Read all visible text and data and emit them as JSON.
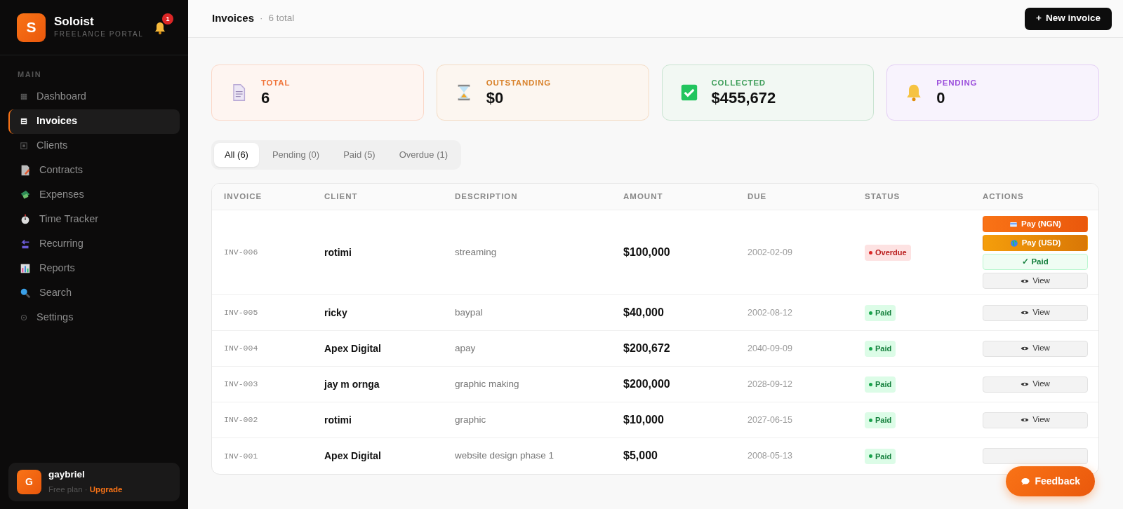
{
  "brand": {
    "logo_letter": "S",
    "name": "Soloist",
    "tagline": "FREELANCE PORTAL",
    "notification_count": "1"
  },
  "sidebar": {
    "section": "MAIN",
    "items": [
      {
        "label": "Dashboard",
        "selected": false
      },
      {
        "label": "Invoices",
        "selected": true
      },
      {
        "label": "Clients",
        "selected": false
      },
      {
        "label": "Contracts",
        "selected": false
      },
      {
        "label": "Expenses",
        "selected": false
      },
      {
        "label": "Time Tracker",
        "selected": false
      },
      {
        "label": "Recurring",
        "selected": false
      },
      {
        "label": "Reports",
        "selected": false
      },
      {
        "label": "Search",
        "selected": false
      },
      {
        "label": "Settings",
        "selected": false
      }
    ]
  },
  "user": {
    "initial": "G",
    "name": "gaybriel",
    "plan": "Free plan",
    "separator": "·",
    "upgrade": "Upgrade"
  },
  "header": {
    "title": "Invoices",
    "separator": "·",
    "count": "6 total",
    "new_button": "New invoice",
    "new_button_icon": "+"
  },
  "stats": [
    {
      "label": "TOTAL",
      "value": "6",
      "color": "#f0743a"
    },
    {
      "label": "OUTSTANDING",
      "value": "$0",
      "color": "#d9822b"
    },
    {
      "label": "COLLECTED",
      "value": "$455,672",
      "color": "#3f9e5a"
    },
    {
      "label": "PENDING",
      "value": "0",
      "color": "#9b4fdc"
    }
  ],
  "filters": [
    {
      "label": "All (6)",
      "selected": true
    },
    {
      "label": "Pending (0)",
      "selected": false
    },
    {
      "label": "Paid (5)",
      "selected": false
    },
    {
      "label": "Overdue (1)",
      "selected": false
    }
  ],
  "table": {
    "columns": [
      "INVOICE",
      "CLIENT",
      "DESCRIPTION",
      "AMOUNT",
      "DUE",
      "STATUS",
      "ACTIONS"
    ],
    "rows": [
      {
        "invoice": "INV-006",
        "client": "rotimi",
        "description": "streaming",
        "amount": "$100,000",
        "due": "2002-02-09",
        "status": {
          "kind": "overdue",
          "label": "Overdue"
        },
        "actions": [
          {
            "kind": "pay_ngn",
            "label": "Pay (NGN)"
          },
          {
            "kind": "pay_usd",
            "label": "Pay (USD)"
          },
          {
            "kind": "mark_paid",
            "label": "✓ Paid"
          },
          {
            "kind": "view",
            "label": "View"
          }
        ]
      },
      {
        "invoice": "INV-005",
        "client": "ricky",
        "description": "baypal",
        "amount": "$40,000",
        "due": "2002-08-12",
        "status": {
          "kind": "paid",
          "label": "Paid"
        },
        "actions": [
          {
            "kind": "view",
            "label": "View"
          }
        ]
      },
      {
        "invoice": "INV-004",
        "client": "Apex Digital",
        "description": "apay",
        "amount": "$200,672",
        "due": "2040-09-09",
        "status": {
          "kind": "paid",
          "label": "Paid"
        },
        "actions": [
          {
            "kind": "view",
            "label": "View"
          }
        ]
      },
      {
        "invoice": "INV-003",
        "client": "jay m ornga",
        "description": "graphic making",
        "amount": "$200,000",
        "due": "2028-09-12",
        "status": {
          "kind": "paid",
          "label": "Paid"
        },
        "actions": [
          {
            "kind": "view",
            "label": "View"
          }
        ]
      },
      {
        "invoice": "INV-002",
        "client": "rotimi",
        "description": "graphic",
        "amount": "$10,000",
        "due": "2027-06-15",
        "status": {
          "kind": "paid",
          "label": "Paid"
        },
        "actions": [
          {
            "kind": "view",
            "label": "View"
          }
        ]
      },
      {
        "invoice": "INV-001",
        "client": "Apex Digital",
        "description": "website design phase 1",
        "amount": "$5,000",
        "due": "2008-05-13",
        "status": {
          "kind": "paid",
          "label": "Paid"
        },
        "actions": [
          {
            "kind": "view_covered"
          }
        ]
      }
    ]
  },
  "feedback_button": "Feedback"
}
